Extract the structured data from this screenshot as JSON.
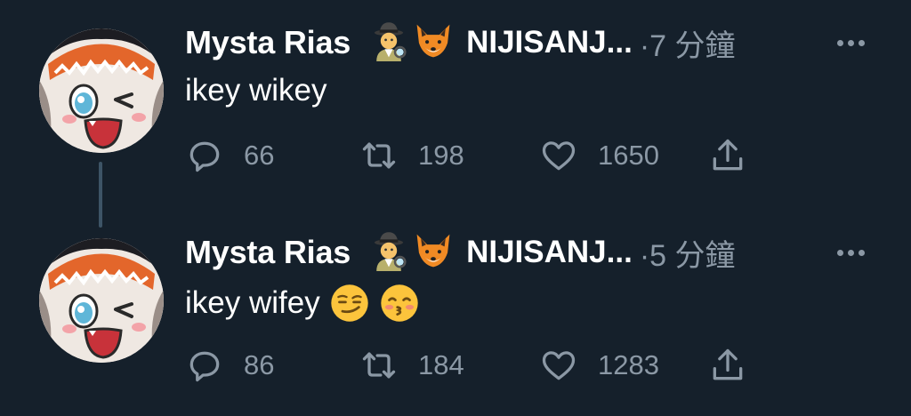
{
  "colors": {
    "background": "#15202b",
    "text_primary": "#ffffff",
    "text_secondary": "#8b98a5",
    "thread_line": "#3d5466"
  },
  "tweets": [
    {
      "author_name": "Mysta Rias",
      "name_emojis": [
        "detective-emoji",
        "fox-emoji"
      ],
      "org_name": "NIJISANJ...",
      "timestamp": "·7 分鐘",
      "text": "ikey wikey",
      "text_emojis": [],
      "reply_count": "66",
      "retweet_count": "198",
      "like_count": "1650"
    },
    {
      "author_name": "Mysta Rias",
      "name_emojis": [
        "detective-emoji",
        "fox-emoji"
      ],
      "org_name": "NIJISANJ...",
      "timestamp": "·5 分鐘",
      "text": "ikey wifey",
      "text_emojis": [
        "smirking-face-emoji",
        "kissing-face-emoji"
      ],
      "reply_count": "86",
      "retweet_count": "184",
      "like_count": "1283"
    }
  ],
  "icons": {
    "reply": "speech-bubble-icon",
    "retweet": "retweet-arrows-icon",
    "like": "heart-outline-icon",
    "share": "share-upload-icon",
    "more": "ellipsis-icon"
  }
}
